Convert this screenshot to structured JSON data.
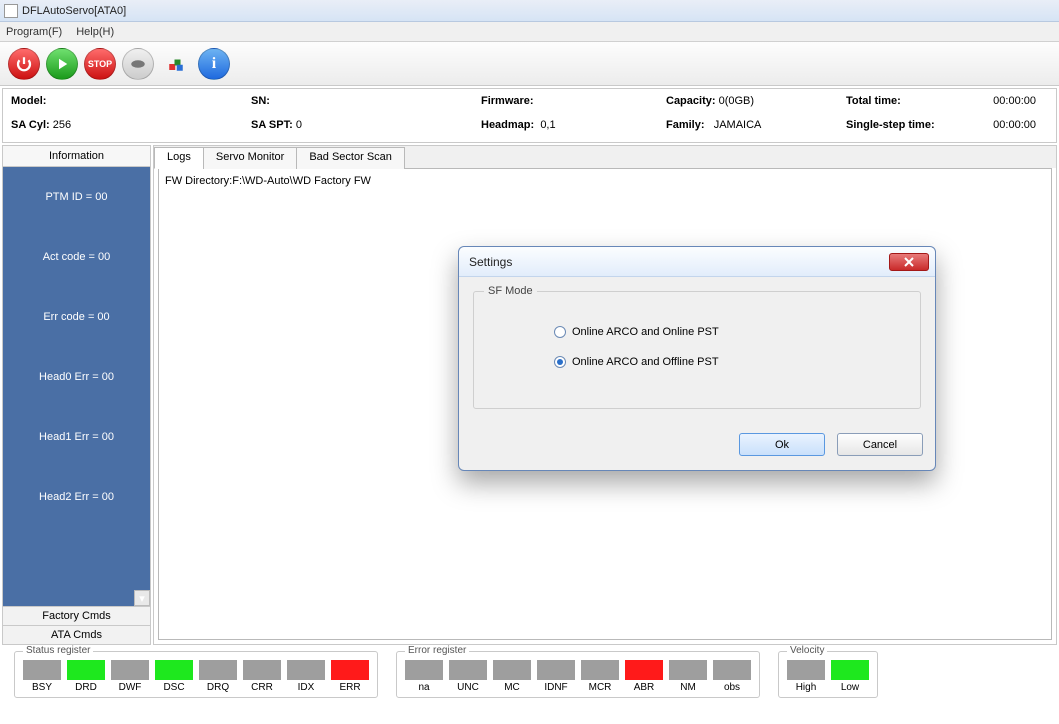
{
  "window": {
    "title": "DFLAutoServo[ATA0]"
  },
  "menu": {
    "program": "Program(F)",
    "help": "Help(H)"
  },
  "info": {
    "model_l": "Model:",
    "model_v": "",
    "sn_l": "SN:",
    "sn_v": "",
    "fw_l": "Firmware:",
    "fw_v": "",
    "cap_l": "Capacity:",
    "cap_v": "0(0GB)",
    "tt_l": "Total time:",
    "tt_v": "00:00:00",
    "sacyl_l": "SA Cyl:",
    "sacyl_v": "256",
    "saspt_l": "SA SPT:",
    "saspt_v": "0",
    "hm_l": "Headmap:",
    "hm_v": "0,1",
    "fam_l": "Family:",
    "fam_v": "JAMAICA",
    "sst_l": "Single-step time:",
    "sst_v": "00:00:00"
  },
  "sidebar": {
    "header": "Information",
    "items": [
      "PTM ID = 00",
      "Act code = 00",
      "Err code = 00",
      "Head0 Err = 00",
      "Head1 Err = 00",
      "Head2 Err = 00"
    ],
    "btn1": "Factory Cmds",
    "btn2": "ATA Cmds"
  },
  "tabs": {
    "t0": "Logs",
    "t1": "Servo Monitor",
    "t2": "Bad Sector Scan"
  },
  "log": {
    "line0": "FW Directory:F:\\WD-Auto\\WD Factory FW"
  },
  "status": {
    "title": "Status register",
    "names": [
      "BSY",
      "DRD",
      "DWF",
      "DSC",
      "DRQ",
      "CRR",
      "IDX",
      "ERR"
    ],
    "colors": [
      "off",
      "on",
      "off",
      "on",
      "off",
      "off",
      "off",
      "err"
    ]
  },
  "error": {
    "title": "Error register",
    "names": [
      "na",
      "UNC",
      "MC",
      "IDNF",
      "MCR",
      "ABR",
      "NM",
      "obs"
    ],
    "colors": [
      "off",
      "off",
      "off",
      "off",
      "off",
      "err",
      "off",
      "off"
    ]
  },
  "velocity": {
    "title": "Velocity",
    "names": [
      "High",
      "Low"
    ],
    "colors": [
      "off",
      "on"
    ]
  },
  "dialog": {
    "title": "Settings",
    "legend": "SF Mode",
    "opt0": "Online ARCO and Online PST",
    "opt1": "Online ARCO and Offline PST",
    "ok": "Ok",
    "cancel": "Cancel"
  }
}
